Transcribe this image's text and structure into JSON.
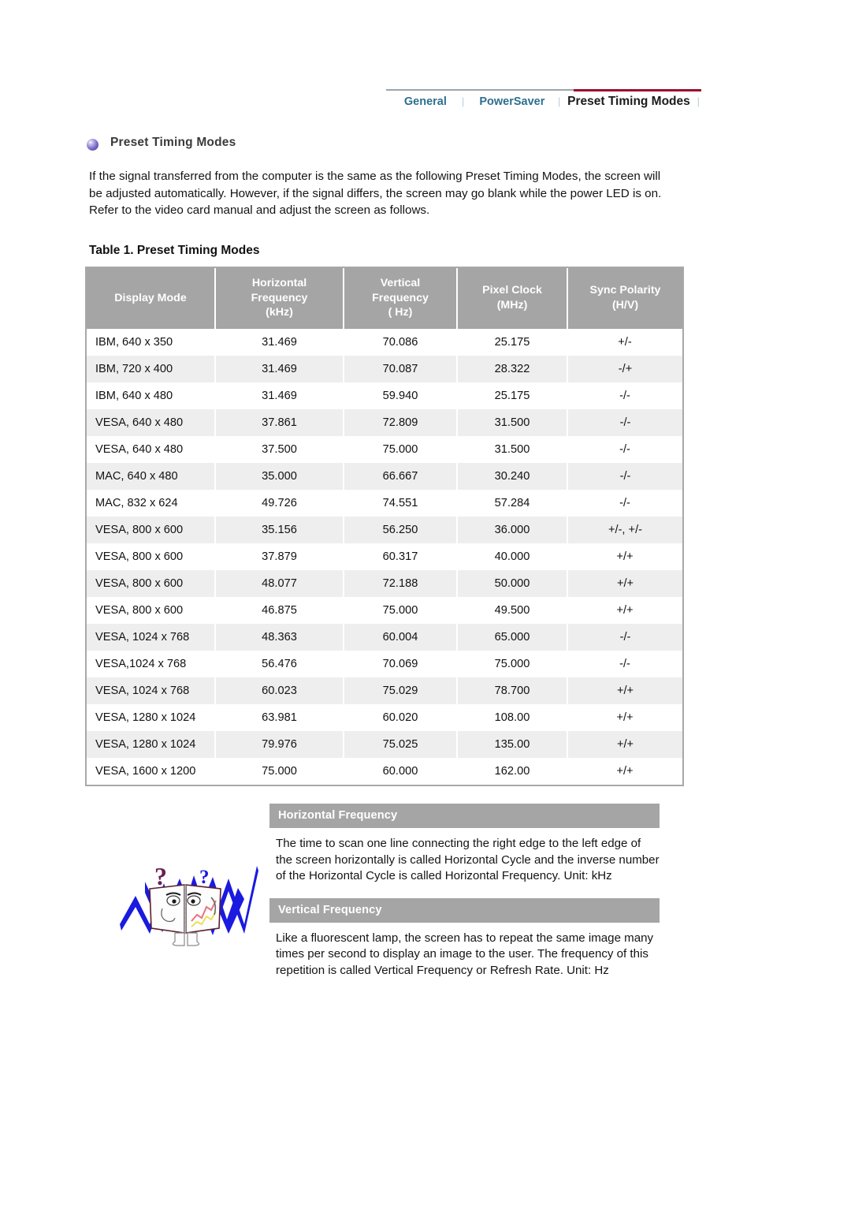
{
  "nav": {
    "items": [
      {
        "label": "General",
        "active": false
      },
      {
        "label": "PowerSaver",
        "active": false
      },
      {
        "label": "Preset Timing Modes",
        "active": true
      }
    ],
    "separator": "⌷",
    "link_color": "#2d6f8e",
    "active_color": "#1b1b1b",
    "active_rule_color": "#9e0b2b",
    "rule_color": "#9aa5ab"
  },
  "section": {
    "title": "Preset Timing Modes",
    "intro": "If the signal transferred from the computer is the same as the following Preset Timing Modes, the screen will be adjusted automatically. However, if the signal differs, the screen may go blank while the power LED is on. Refer to the video card manual and adjust the screen as follows."
  },
  "table": {
    "caption": "Table 1. Preset Timing Modes",
    "header_bg": "#a5a5a5",
    "stripe_bg": "#eeeeee",
    "columns": [
      "Display Mode",
      "Horizontal\nFrequency\n(kHz)",
      "Vertical\nFrequency\n( Hz)",
      "Pixel Clock\n(MHz)",
      "Sync Polarity\n(H/V)"
    ],
    "columns_lines": [
      [
        "Display Mode"
      ],
      [
        "Horizontal",
        "Frequency",
        "(kHz)"
      ],
      [
        "Vertical",
        "Frequency",
        "( Hz)"
      ],
      [
        "Pixel Clock",
        "(MHz)"
      ],
      [
        "Sync Polarity",
        "(H/V)"
      ]
    ],
    "rows": [
      [
        "IBM, 640 x 350",
        "31.469",
        "70.086",
        "25.175",
        "+/-"
      ],
      [
        "IBM, 720 x 400",
        "31.469",
        "70.087",
        "28.322",
        "-/+"
      ],
      [
        "IBM, 640 x 480",
        "31.469",
        "59.940",
        "25.175",
        "-/-"
      ],
      [
        "VESA, 640 x 480",
        "37.861",
        "72.809",
        "31.500",
        "-/-"
      ],
      [
        "VESA, 640 x 480",
        "37.500",
        "75.000",
        "31.500",
        "-/-"
      ],
      [
        "MAC, 640 x 480",
        "35.000",
        "66.667",
        "30.240",
        "-/-"
      ],
      [
        "MAC, 832 x 624",
        "49.726",
        "74.551",
        "57.284",
        "-/-"
      ],
      [
        "VESA, 800 x 600",
        "35.156",
        "56.250",
        "36.000",
        "+/-, +/-"
      ],
      [
        "VESA, 800 x 600",
        "37.879",
        "60.317",
        "40.000",
        "+/+"
      ],
      [
        "VESA, 800 x 600",
        "48.077",
        "72.188",
        "50.000",
        "+/+"
      ],
      [
        "VESA, 800 x 600",
        "46.875",
        "75.000",
        "49.500",
        "+/+"
      ],
      [
        "VESA, 1024 x 768",
        "48.363",
        "60.004",
        "65.000",
        "-/-"
      ],
      [
        "VESA,1024 x 768",
        "56.476",
        "70.069",
        "75.000",
        "-/-"
      ],
      [
        "VESA, 1024 x 768",
        "60.023",
        "75.029",
        "78.700",
        "+/+"
      ],
      [
        "VESA, 1280 x 1024",
        "63.981",
        "60.020",
        "108.00",
        "+/+"
      ],
      [
        "VESA, 1280 x 1024",
        "79.976",
        "75.025",
        "135.00",
        "+/+"
      ],
      [
        "VESA, 1600 x 1200",
        "75.000",
        "60.000",
        "162.00",
        "+/+"
      ]
    ]
  },
  "panels": [
    {
      "title": "Horizontal Frequency",
      "body": "The time to scan one line connecting the right edge to the left edge of the screen horizontally is called Horizontal Cycle and the inverse number of the Horizontal Cycle is called Horizontal Frequency. Unit: kHz"
    },
    {
      "title": "Vertical Frequency",
      "body": "Like a fluorescent lamp, the screen has to repeat the same image many times per second to display an image to the user. The frequency of this repetition is called Vertical Frequency or Refresh Rate. Unit: Hz"
    }
  ],
  "illustration": {
    "name": "open-book-character-with-question-marks",
    "zigzag_color": "#1a1ae0",
    "question_mark_colors": [
      "#6b2050",
      "#1a1ae0"
    ]
  }
}
